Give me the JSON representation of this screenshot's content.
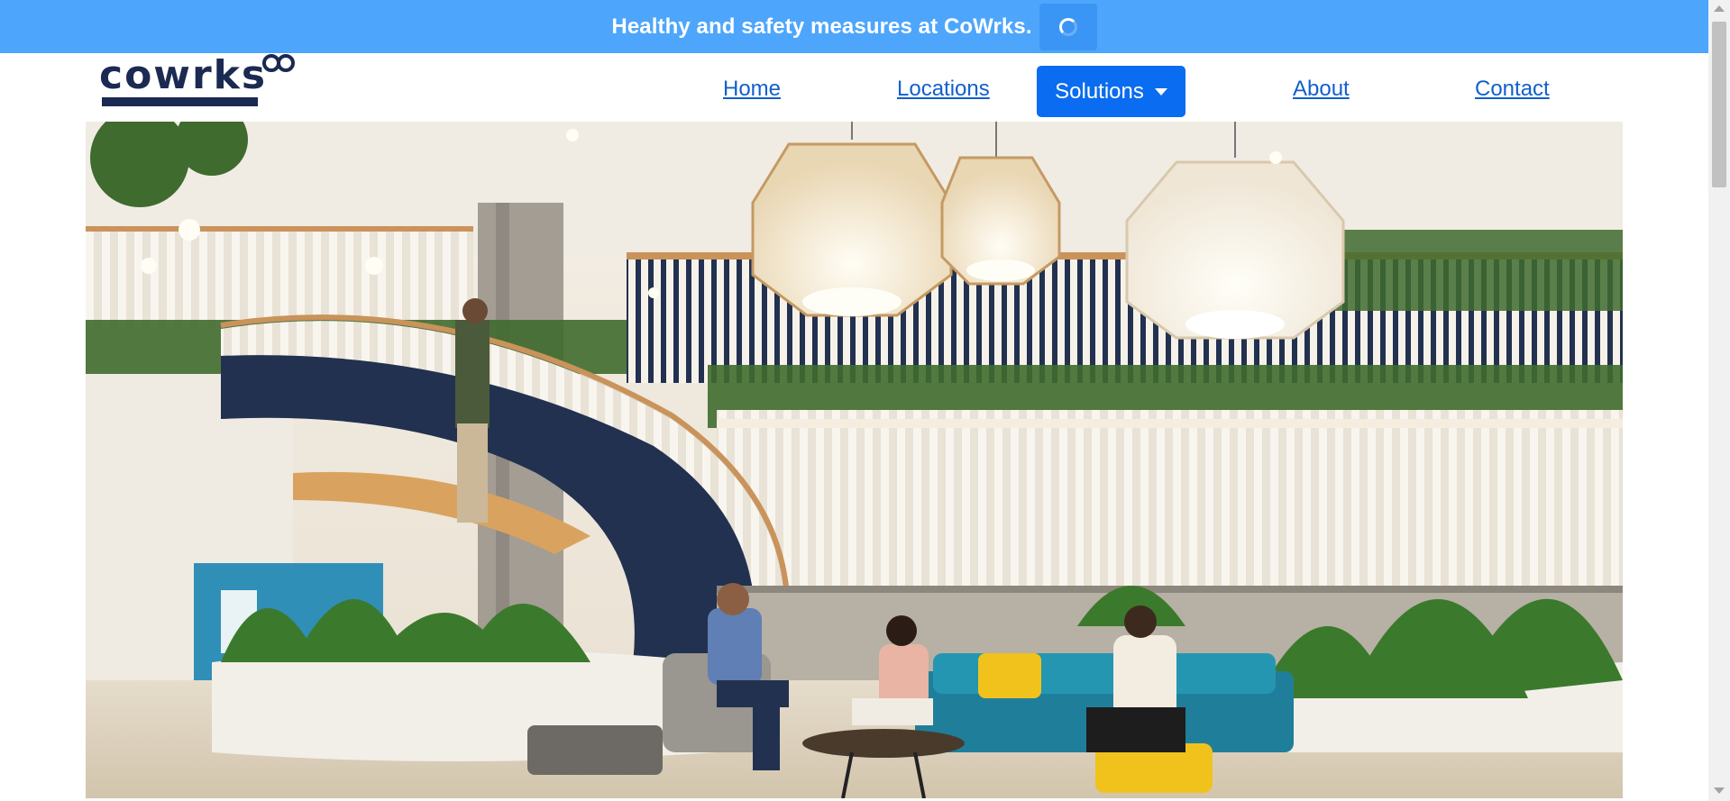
{
  "announcement": {
    "text": "Healthy and safety measures at CoWrks.",
    "button_icon": "spinner-icon",
    "background_color": "#4da6fb"
  },
  "logo": {
    "text": "cowrks",
    "icon": "infinity-icon",
    "color": "#1b2a52"
  },
  "nav": {
    "home": "Home",
    "locations": "Locations",
    "solutions": "Solutions",
    "about": "About",
    "contact": "Contact",
    "link_color": "#1160cc",
    "active_button_color": "#0a6cf0"
  },
  "hero": {
    "image_subject": "coworking atrium with spiral staircase, rattan pendant lamps, hanging plants and people seated on sofas"
  }
}
